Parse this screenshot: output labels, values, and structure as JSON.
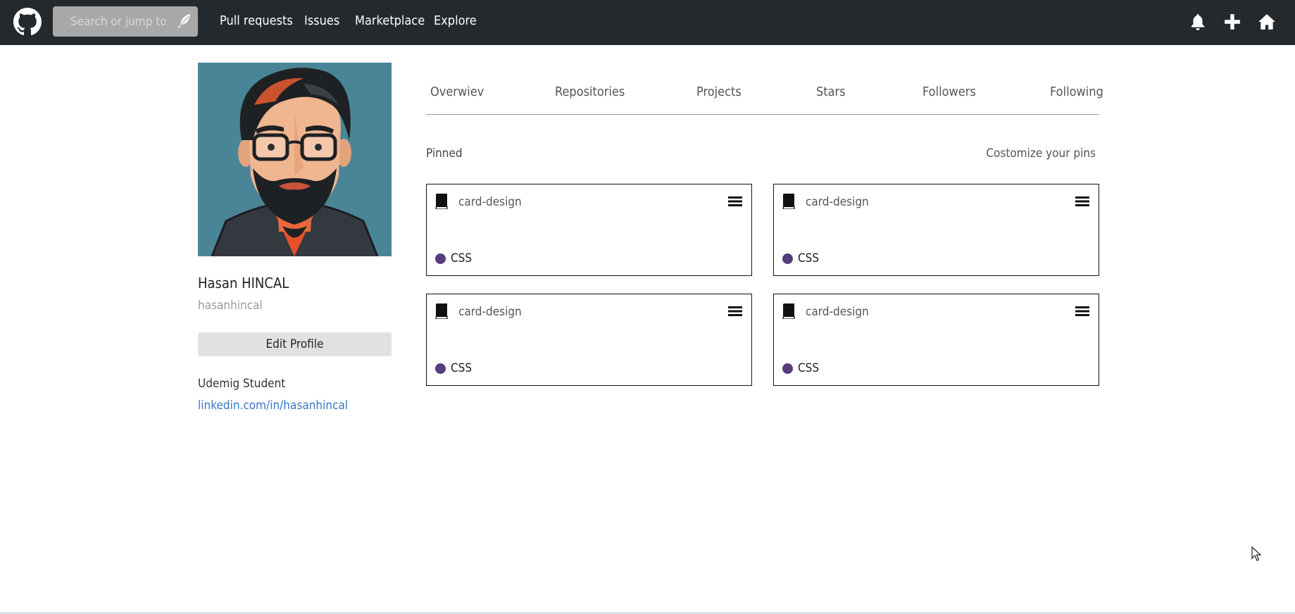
{
  "header": {
    "search": {
      "placeholder": "Search or jump to..."
    },
    "nav": [
      "Pull requests",
      "Issues",
      "Marketplace",
      "Explore"
    ],
    "icons": [
      "github-logo-icon",
      "feather-icon",
      "bell-icon",
      "plus-icon",
      "home-icon"
    ]
  },
  "profile": {
    "full_name": "Hasan HINCAL",
    "username": "hasanhincal",
    "edit_label": "Edit Profile",
    "bio": "Udemig Student",
    "link": "linkedin.com/in/hasanhincal"
  },
  "tabs": [
    "Overwiev",
    "Repositories",
    "Projects",
    "Stars",
    "Followers",
    "Following"
  ],
  "pinned": {
    "title": "Pinned",
    "customize_label": "Costomize your pins",
    "cards": [
      {
        "name": "card-design",
        "language": "CSS",
        "lang_color": "#563d7c"
      },
      {
        "name": "card-design",
        "language": "CSS",
        "lang_color": "#563d7c"
      },
      {
        "name": "card-design",
        "language": "CSS",
        "lang_color": "#563d7c"
      },
      {
        "name": "card-design",
        "language": "CSS",
        "lang_color": "#563d7c"
      }
    ]
  },
  "colors": {
    "header_bg": "#24292e",
    "link": "#3d75c4",
    "css_dot": "#563d7c"
  }
}
